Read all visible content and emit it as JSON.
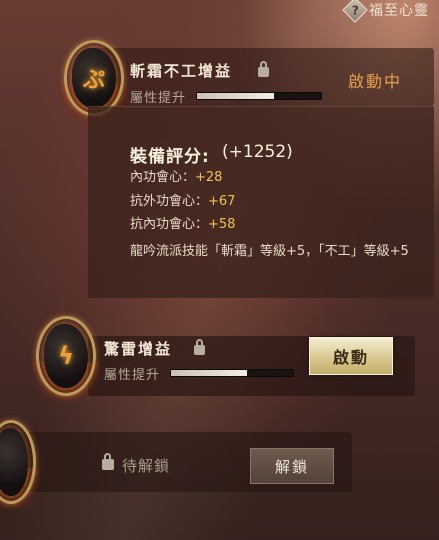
{
  "header": {
    "help_icon": "diamond-question-icon",
    "link_label": "福至心靈"
  },
  "items": [
    {
      "title": "斬霜不工增益",
      "sub_label": "屬性提升",
      "progress": 0.62,
      "status": "啟動中",
      "lock_icon": "lock-open-icon",
      "emblem_icon": "rune-stone-icon"
    },
    {
      "title": "驚雷增益",
      "sub_label": "屬性提升",
      "progress": 0.62,
      "button": "啟動",
      "lock_icon": "lock-icon",
      "emblem_icon": "lightning-rune-icon"
    },
    {
      "status": "待解鎖",
      "button": "解鎖",
      "lock_icon": "lock-icon",
      "emblem_icon": "rune-stone-icon"
    }
  ],
  "tooltip": {
    "title": "裝備評分:",
    "score": "(+1252)",
    "stats": [
      {
        "label": "內功會心：",
        "value": "+28"
      },
      {
        "label": "抗外功會心：",
        "value": "+67"
      },
      {
        "label": "抗內功會心：",
        "value": "+58"
      }
    ],
    "description": "龍吟流派技能「斬霜」等級+5，「不工」等級+5"
  },
  "colors": {
    "status_active": "#e6a04e",
    "stat_value": "#f0c150",
    "button_gold": "#d9c990"
  }
}
